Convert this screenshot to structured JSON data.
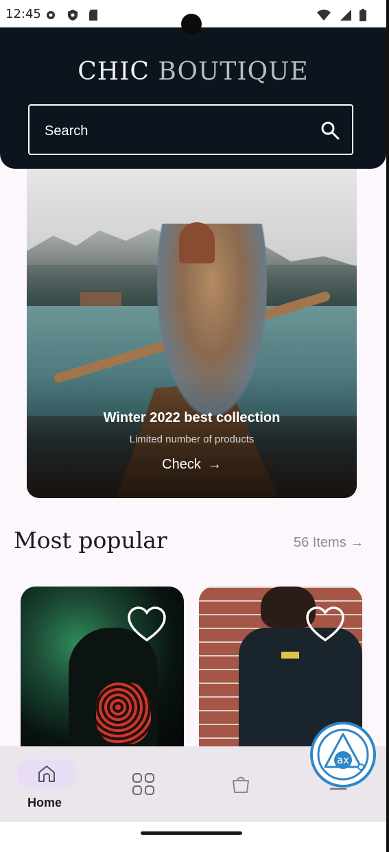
{
  "status_bar": {
    "time": "12:45"
  },
  "header": {
    "brand_word1": "CHIC",
    "brand_word2": "BOUTIQUE",
    "search_placeholder": "Search"
  },
  "hero": {
    "title": "Winter 2022 best collection",
    "subtitle": "Limited number of products",
    "cta_label": "Check"
  },
  "section": {
    "title": "Most popular",
    "count_label": "56 Items"
  },
  "bottom_nav": {
    "items": [
      {
        "label": "Home",
        "icon": "home-icon",
        "selected": true
      },
      {
        "label": "",
        "icon": "grid-icon",
        "selected": false
      },
      {
        "label": "",
        "icon": "shopping-bag-icon",
        "selected": false
      },
      {
        "label": "",
        "icon": "menu-icon",
        "selected": false
      }
    ]
  },
  "colors": {
    "header_bg": "#0c141e",
    "nav_bg": "#ebe6ec",
    "nav_selected_pill": "#e9ddf6",
    "accent_badge": "#2f86c8"
  }
}
